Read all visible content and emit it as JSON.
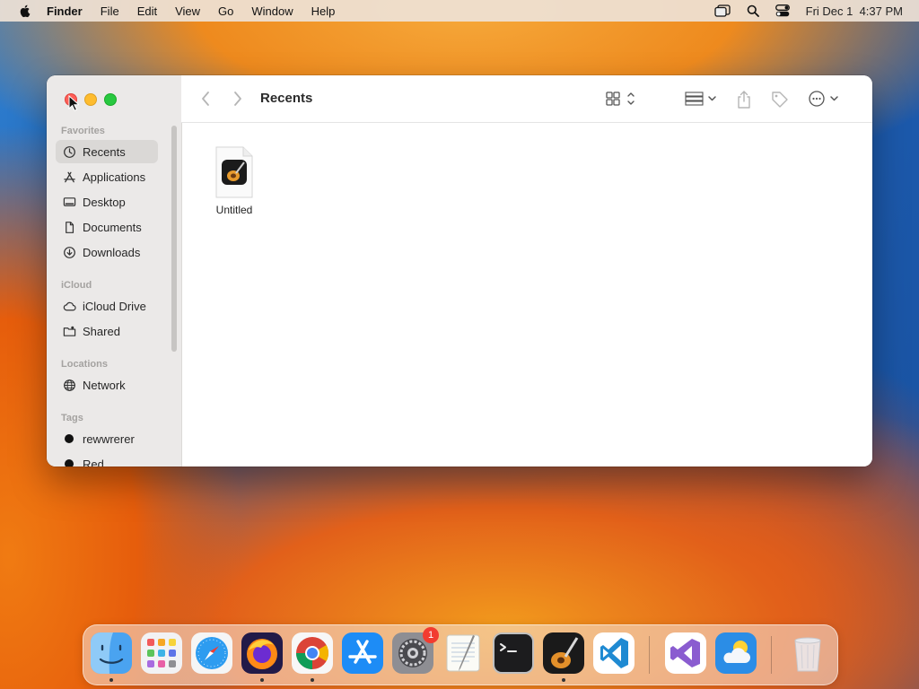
{
  "menubar": {
    "app_name": "Finder",
    "menus": [
      "File",
      "Edit",
      "View",
      "Go",
      "Window",
      "Help"
    ],
    "clock": "Fri Dec 1  4:37 PM"
  },
  "window": {
    "title": "Recents",
    "sidebar": {
      "favorites_title": "Favorites",
      "favorites": [
        "Recents",
        "Applications",
        "Desktop",
        "Documents",
        "Downloads"
      ],
      "icloud_title": "iCloud",
      "icloud": [
        "iCloud Drive",
        "Shared"
      ],
      "locations_title": "Locations",
      "locations": [
        "Network"
      ],
      "tags_title": "Tags",
      "tags": [
        "rewwrerer",
        "Red"
      ],
      "selected": "Recents"
    },
    "files": [
      {
        "name": "Untitled",
        "icon": "garageband-document-icon"
      }
    ]
  },
  "dock": {
    "apps": [
      "Finder",
      "Launchpad",
      "Safari",
      "Firefox",
      "Chrome",
      "App Store",
      "System Settings",
      "TextEdit",
      "Terminal",
      "GarageBand",
      "Visual Studio Code",
      "Visual Studio",
      "Weather",
      "Trash"
    ],
    "system_settings_badge": "1"
  },
  "colors": {
    "close": "#fe5f57",
    "minimize": "#febc2e",
    "maximize": "#28c840",
    "selection": "#dad8d6",
    "badge": "#f23b30"
  }
}
